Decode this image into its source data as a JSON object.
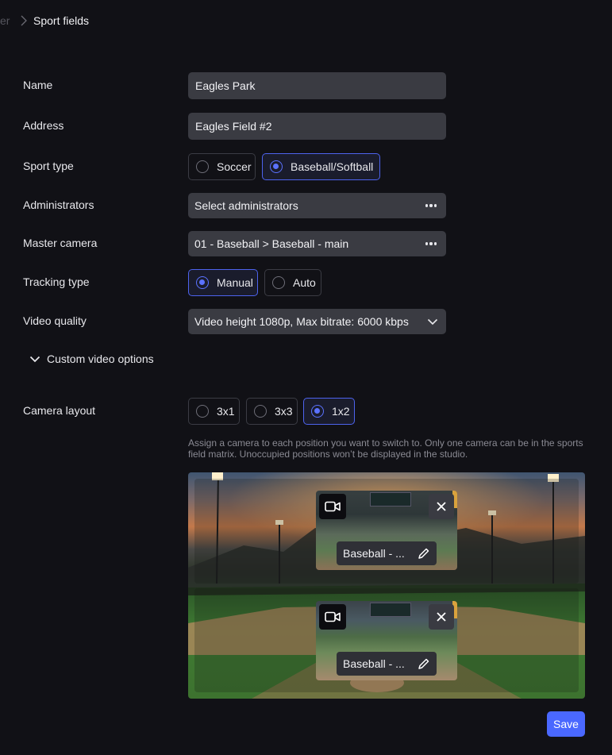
{
  "breadcrumb": {
    "previous": "er",
    "current": "Sport fields"
  },
  "form": {
    "name": {
      "label": "Name",
      "value": "Eagles Park"
    },
    "address": {
      "label": "Address",
      "value": "Eagles Field #2"
    },
    "sport_type": {
      "label": "Sport type",
      "options": [
        "Soccer",
        "Baseball/Softball"
      ],
      "selected": "Baseball/Softball"
    },
    "administrators": {
      "label": "Administrators",
      "value": "Select administrators"
    },
    "master_camera": {
      "label": "Master camera",
      "value": "01 - Baseball > Baseball - main"
    },
    "tracking_type": {
      "label": "Tracking type",
      "options": [
        "Manual",
        "Auto"
      ],
      "selected": "Manual"
    },
    "video_quality": {
      "label": "Video quality",
      "value": "Video height 1080p, Max bitrate: 6000 kbps"
    },
    "custom_video_options": {
      "label": "Custom video options"
    },
    "camera_layout": {
      "label": "Camera layout",
      "options": [
        "3x1",
        "3x3",
        "1x2"
      ],
      "selected": "1x2",
      "hint": "Assign a camera to each position you want to switch to. Only one camera can be in the sports field matrix. Unoccupied positions won’t be displayed in the studio."
    }
  },
  "matrix": {
    "cameras": [
      {
        "name": "Baseball - ..."
      },
      {
        "name": "Baseball - ..."
      }
    ]
  },
  "actions": {
    "save_label": "Save"
  },
  "colors": {
    "background": "#111116",
    "field": "#3a3b42",
    "accent": "#4a68ff",
    "selected_border": "#4d63ee"
  },
  "icons": [
    "chevron-right-icon",
    "more-dots-icon",
    "chevron-down-icon",
    "video-camera-icon",
    "close-icon",
    "pencil-icon"
  ]
}
